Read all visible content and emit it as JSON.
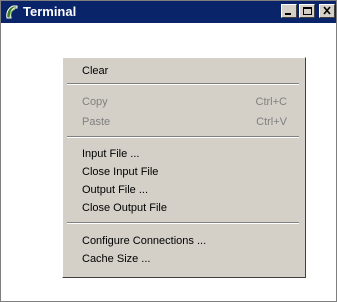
{
  "window": {
    "title": "Terminal",
    "app_icon": "terminal-app-icon",
    "controls": [
      {
        "name": "minimize-button",
        "icon": "minimize-icon"
      },
      {
        "name": "maximize-button",
        "icon": "maximize-icon"
      },
      {
        "name": "close-button",
        "icon": "close-icon"
      }
    ]
  },
  "menu": {
    "items": [
      {
        "label": "Clear",
        "enabled": true
      },
      {
        "label": "Copy",
        "shortcut": "Ctrl+C",
        "enabled": false
      },
      {
        "label": "Paste",
        "shortcut": "Ctrl+V",
        "enabled": false
      },
      {
        "label": "Input File ...",
        "enabled": true
      },
      {
        "label": "Close Input File",
        "enabled": true
      },
      {
        "label": "Output File ...",
        "enabled": true
      },
      {
        "label": "Close Output File",
        "enabled": true
      },
      {
        "label": "Configure Connections ...",
        "enabled": true
      },
      {
        "label": "Cache Size ...",
        "enabled": true
      }
    ]
  },
  "colors": {
    "titlebar": "#0a246a",
    "menu_bg": "#d4d0c8",
    "disabled_text": "#808080"
  }
}
